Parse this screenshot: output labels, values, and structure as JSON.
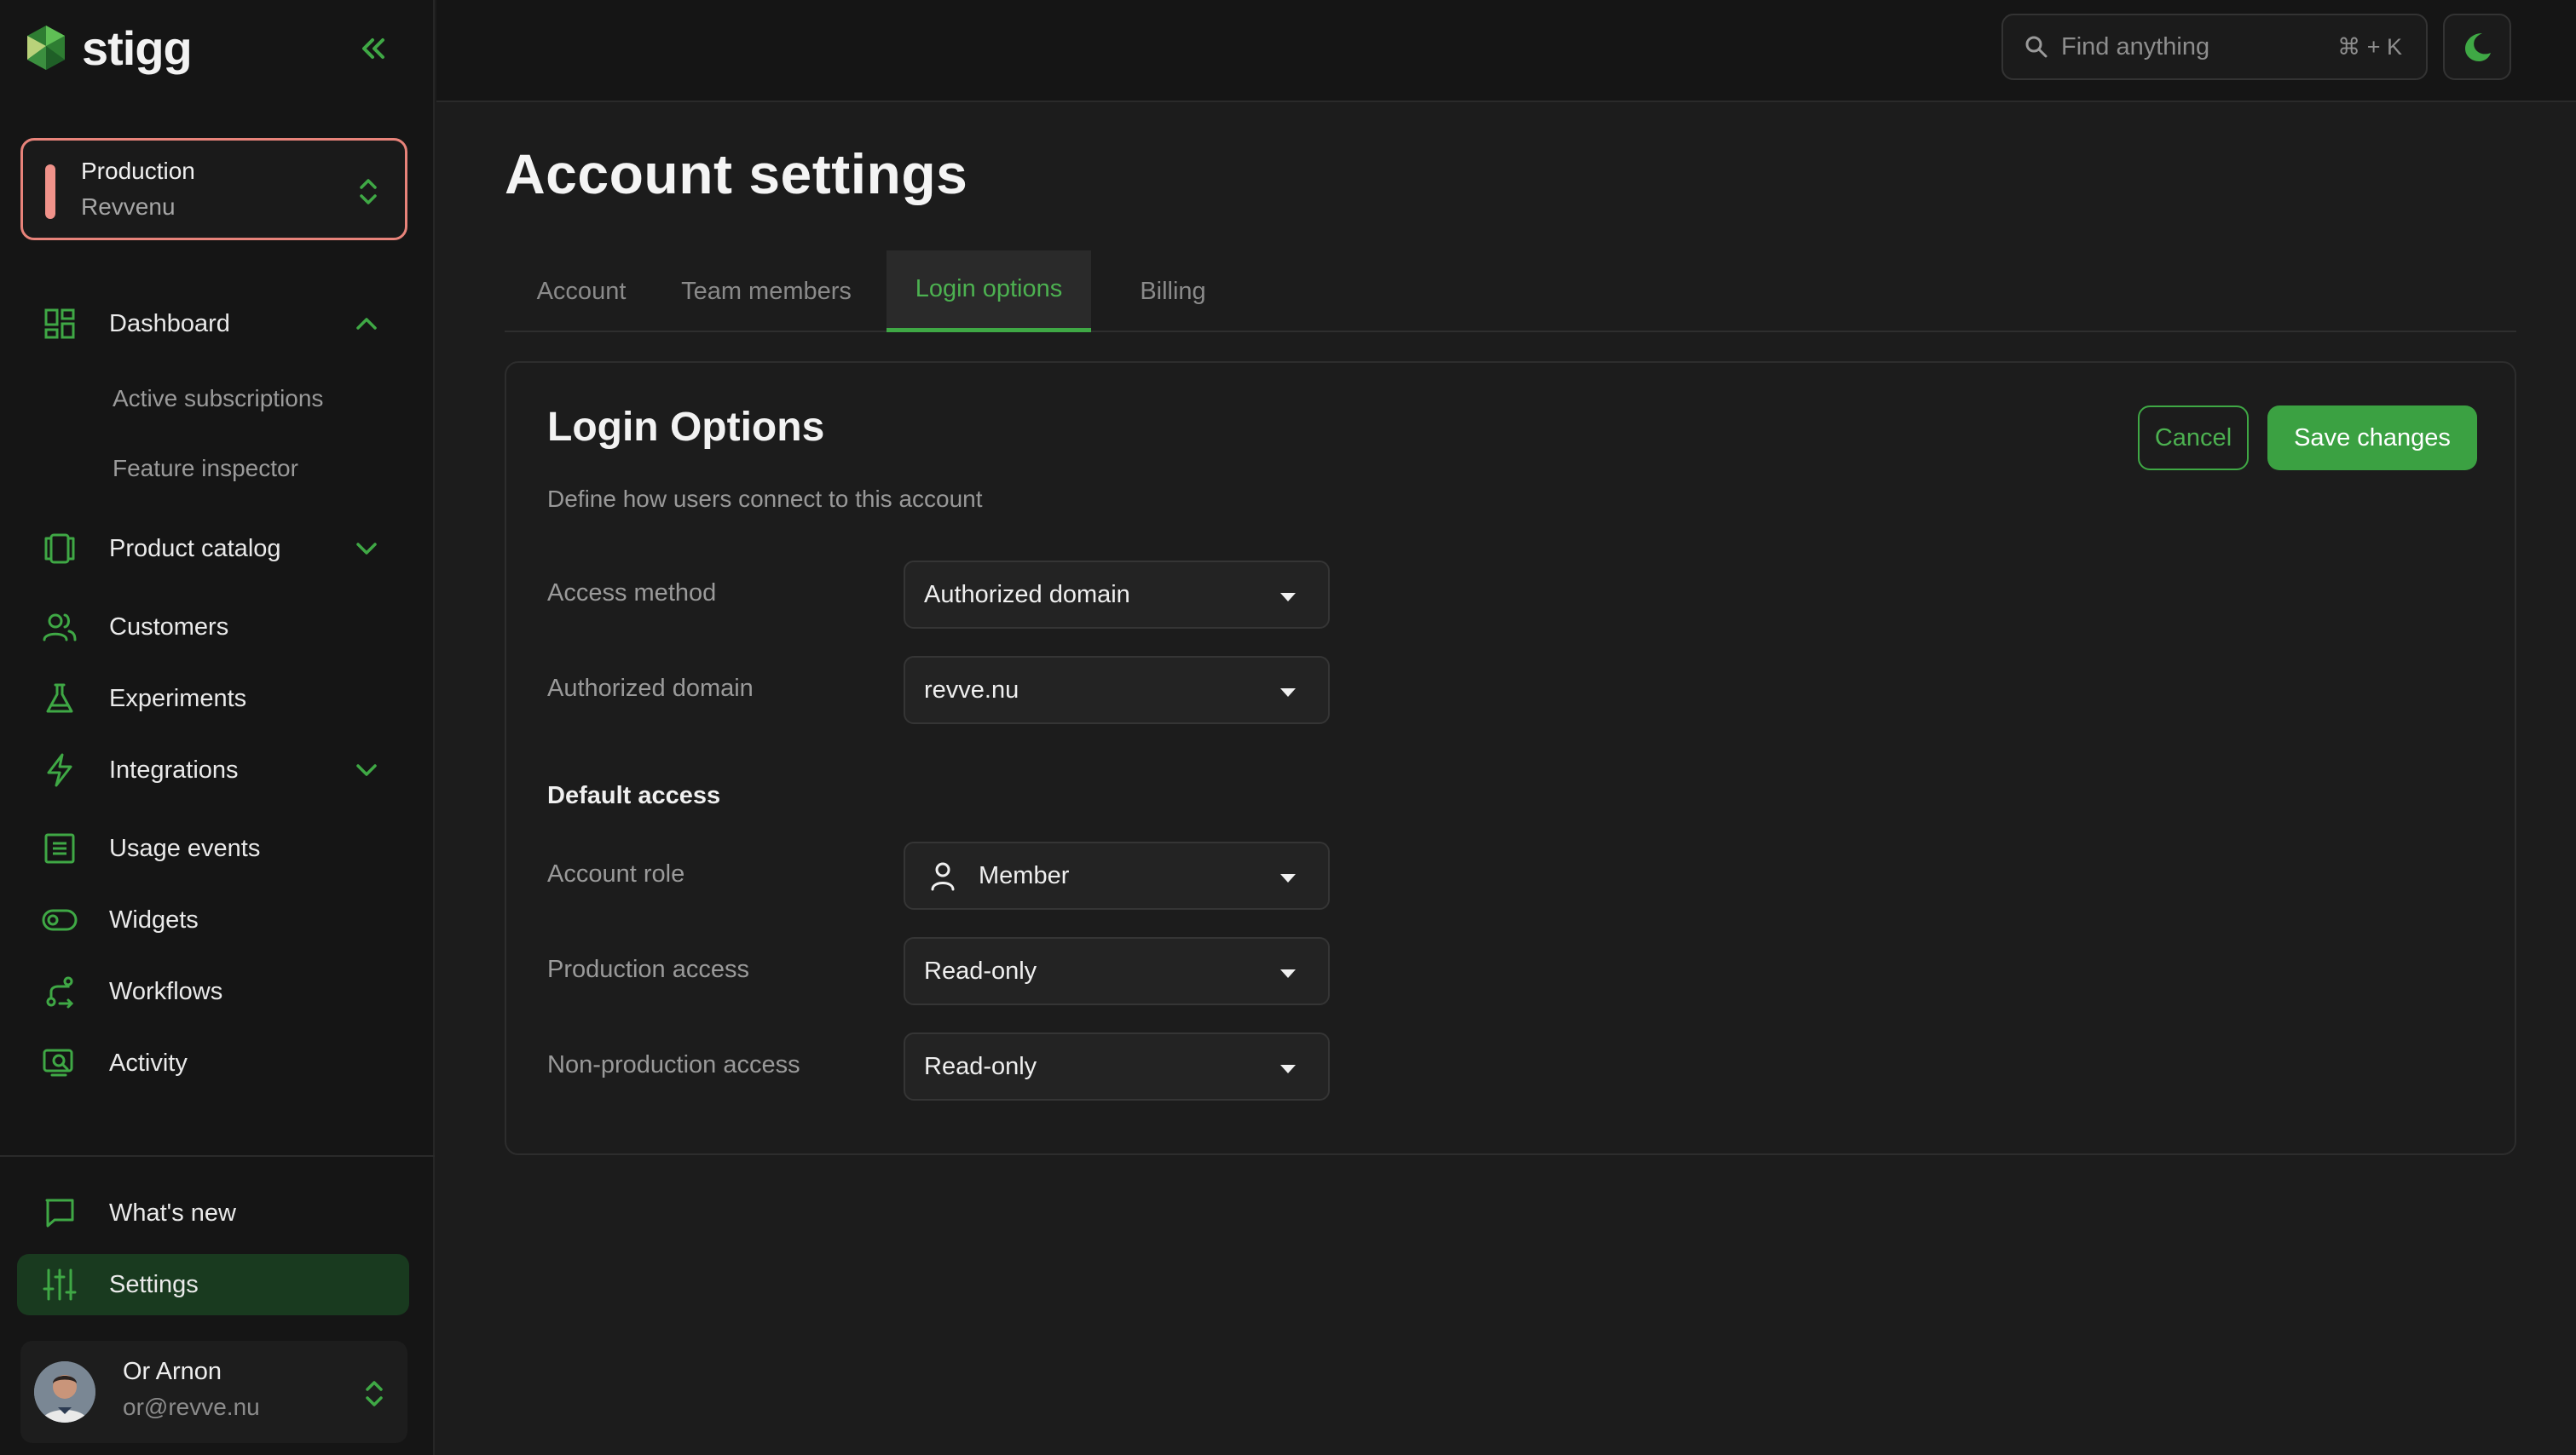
{
  "brand": {
    "name": "stigg"
  },
  "environment": {
    "name": "Production",
    "account": "Revvenu"
  },
  "sidebar": {
    "items": [
      {
        "label": "Dashboard"
      },
      {
        "label": "Product catalog"
      },
      {
        "label": "Customers"
      },
      {
        "label": "Experiments"
      },
      {
        "label": "Integrations"
      },
      {
        "label": "Usage events"
      },
      {
        "label": "Widgets"
      },
      {
        "label": "Workflows"
      },
      {
        "label": "Activity"
      }
    ],
    "dashboard_sub": [
      {
        "label": "Active subscriptions"
      },
      {
        "label": "Feature inspector"
      }
    ],
    "bottom": [
      {
        "label": "What's new"
      },
      {
        "label": "Settings"
      }
    ]
  },
  "user": {
    "name": "Or Arnon",
    "email": "or@revve.nu"
  },
  "search": {
    "placeholder": "Find anything",
    "shortcut": "⌘ + K"
  },
  "page": {
    "title": "Account settings"
  },
  "tabs": [
    {
      "label": "Account"
    },
    {
      "label": "Team members"
    },
    {
      "label": "Login options",
      "active": true
    },
    {
      "label": "Billing"
    }
  ],
  "login_options": {
    "title": "Login Options",
    "description": "Define how users connect to this account",
    "cancel_label": "Cancel",
    "save_label": "Save changes",
    "access_method": {
      "label": "Access method",
      "value": "Authorized domain"
    },
    "authorized_domain": {
      "label": "Authorized domain",
      "value": "revve.nu"
    },
    "default_access_heading": "Default access",
    "account_role": {
      "label": "Account role",
      "value": "Member"
    },
    "production_access": {
      "label": "Production access",
      "value": "Read-only"
    },
    "non_production_access": {
      "label": "Non-production access",
      "value": "Read-only"
    }
  },
  "colors": {
    "accent": "#3fa845",
    "environment": "#e8837a",
    "background": "#1c1c1c",
    "sidebar": "#151515"
  }
}
